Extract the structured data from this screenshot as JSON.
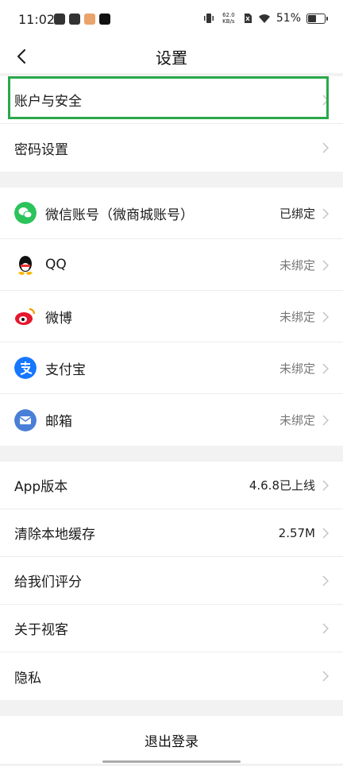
{
  "status_bar": {
    "time": "11:02",
    "net_speed": "62.0",
    "net_unit": "KB/s",
    "battery_text": "51%",
    "battery_level": 0.51
  },
  "header": {
    "title": "设置"
  },
  "account": {
    "security_label": "账户与安全",
    "password_label": "密码设置"
  },
  "bindings": [
    {
      "label": "微信账号（微商城账号）",
      "status": "已绑定",
      "icon": "wechat-icon",
      "color": "#2bc35a"
    },
    {
      "label": "QQ",
      "status": "未绑定",
      "icon": "qq-icon",
      "color": "#111111"
    },
    {
      "label": "微博",
      "status": "未绑定",
      "icon": "weibo-icon",
      "color": "#e6162d"
    },
    {
      "label": "支付宝",
      "status": "未绑定",
      "icon": "alipay-icon",
      "color": "#1677ff"
    },
    {
      "label": "邮箱",
      "status": "未绑定",
      "icon": "mail-icon",
      "color": "#4a7fd8"
    }
  ],
  "misc": {
    "app_version_label": "App版本",
    "app_version_value": "4.6.8已上线",
    "clear_cache_label": "清除本地缓存",
    "clear_cache_value": "2.57M",
    "rate_label": "给我们评分",
    "about_label": "关于视客",
    "privacy_label": "隐私"
  },
  "logout_label": "退出登录",
  "colors": {
    "highlight": "#2aa84a",
    "background": "#f2f2f2"
  }
}
